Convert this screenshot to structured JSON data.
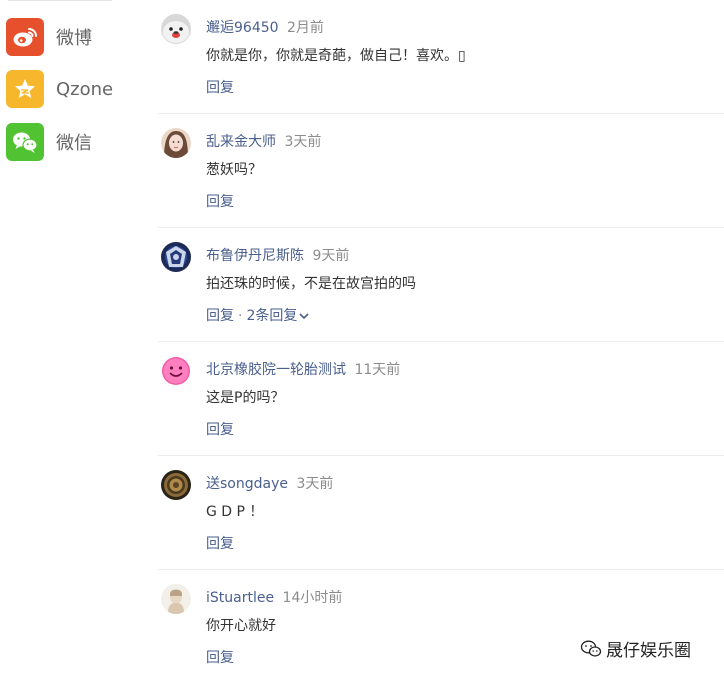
{
  "share": {
    "items": [
      {
        "label": "微博",
        "icon": "weibo-icon",
        "color": "#e6502c"
      },
      {
        "label": "Qzone",
        "icon": "qzone-star-icon",
        "color": "#f6b72c"
      },
      {
        "label": "微信",
        "icon": "wechat-icon",
        "color": "#51c332"
      }
    ]
  },
  "comments": [
    {
      "name": "邂逅96450",
      "time": "2月前",
      "text": "你就是你，你就是奇葩，做自己！喜欢。▯",
      "reply": "回复"
    },
    {
      "name": "乱来金大师",
      "time": "3天前",
      "text": "葱妖吗？",
      "reply": "回复"
    },
    {
      "name": "布鲁伊丹尼斯陈",
      "time": "9天前",
      "text": "拍还珠的时候，不是在故宫拍的吗",
      "reply": "回复",
      "replies": "2条回复"
    },
    {
      "name": "北京橡胶院一轮胎测试",
      "time": "11天前",
      "text": "这是P的吗？",
      "reply": "回复"
    },
    {
      "name": "送songdaye",
      "time": "3天前",
      "text": "G D P ！",
      "reply": "回复"
    },
    {
      "name": "iStuartlee",
      "time": "14小时前",
      "text": "你开心就好",
      "reply": "回复"
    }
  ],
  "watermark": {
    "text": "晟仔娱乐圈"
  }
}
